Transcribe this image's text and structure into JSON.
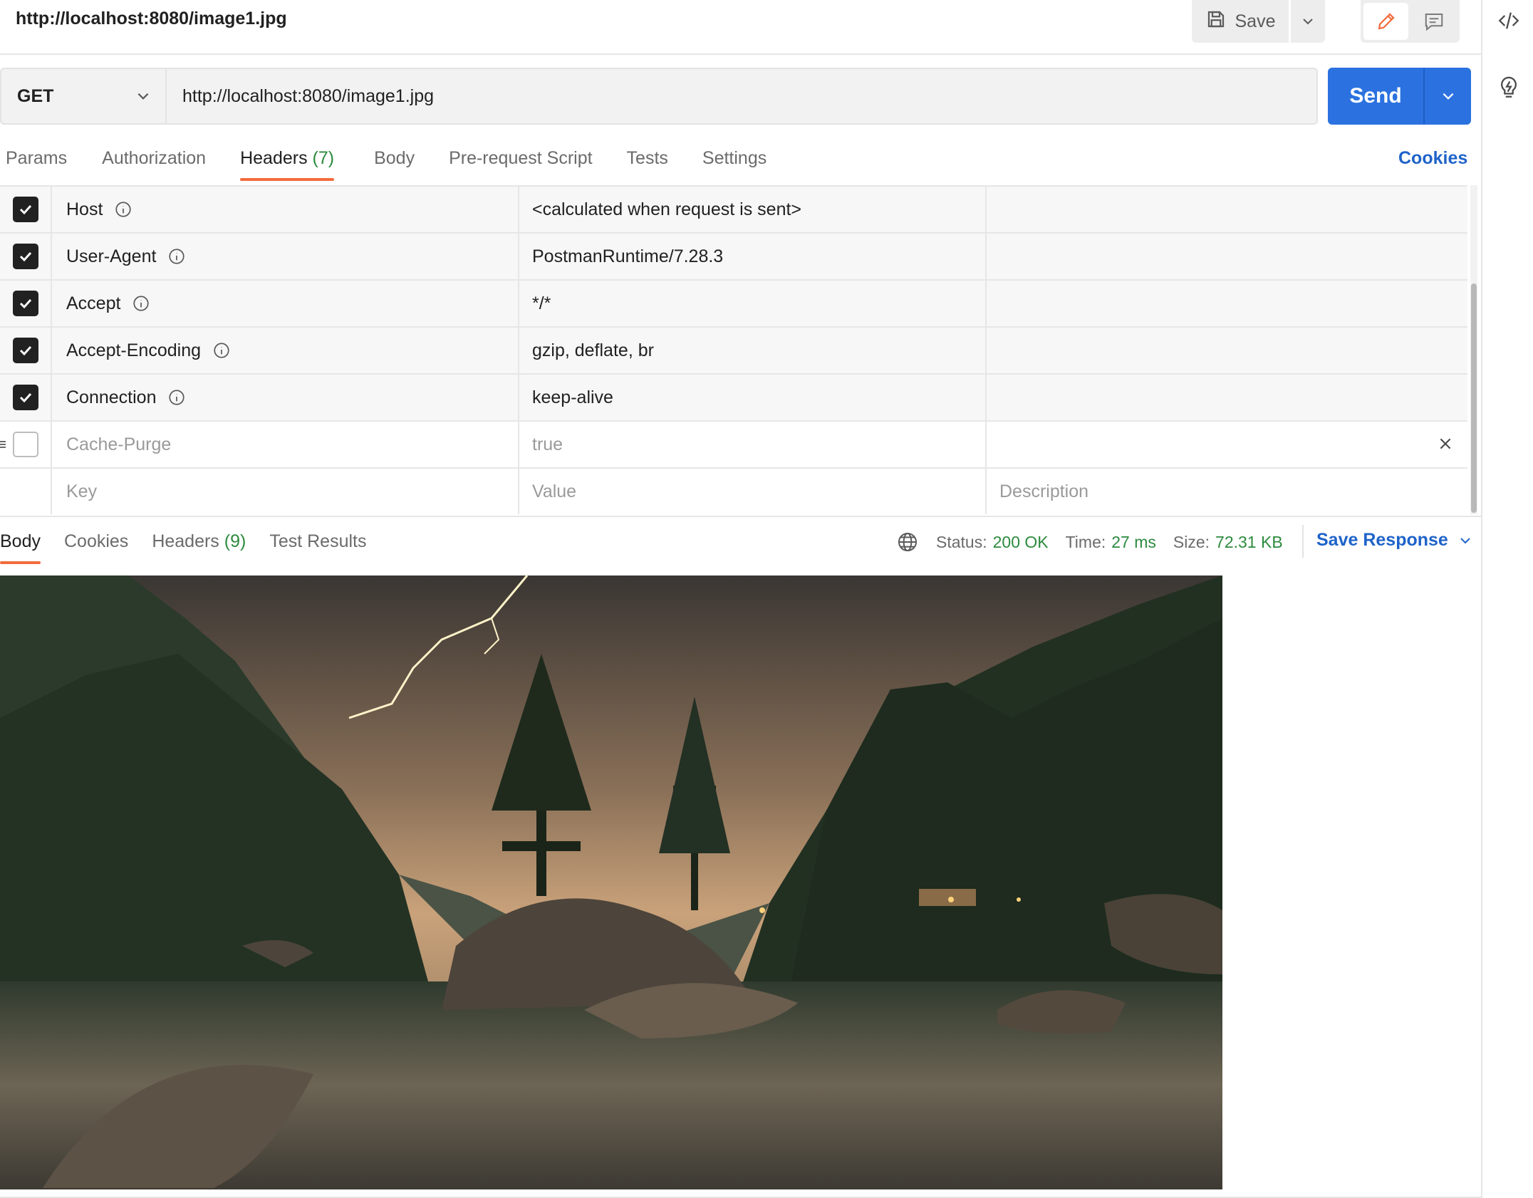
{
  "title": "http://localhost:8080/image1.jpg",
  "toolbar": {
    "save_label": "Save"
  },
  "request": {
    "method": "GET",
    "url": "http://localhost:8080/image1.jpg",
    "send_label": "Send"
  },
  "request_tabs": [
    {
      "label": "Params"
    },
    {
      "label": "Authorization"
    },
    {
      "label": "Headers",
      "count": "(7)"
    },
    {
      "label": "Body"
    },
    {
      "label": "Pre-request Script"
    },
    {
      "label": "Tests"
    },
    {
      "label": "Settings"
    }
  ],
  "active_request_tab": "Headers",
  "cookies_link": "Cookies",
  "headers": [
    {
      "key": "Host",
      "value": "<calculated when request is sent>",
      "checked": true
    },
    {
      "key": "User-Agent",
      "value": "PostmanRuntime/7.28.3",
      "checked": true
    },
    {
      "key": "Accept",
      "value": "*/*",
      "checked": true
    },
    {
      "key": "Accept-Encoding",
      "value": "gzip, deflate, br",
      "checked": true
    },
    {
      "key": "Connection",
      "value": "keep-alive",
      "checked": true
    },
    {
      "key": "Cache-Purge",
      "value": "true",
      "checked": false
    }
  ],
  "new_header": {
    "key_placeholder": "Key",
    "value_placeholder": "Value",
    "description_placeholder": "Description"
  },
  "response_tabs": [
    {
      "label": "Body"
    },
    {
      "label": "Cookies"
    },
    {
      "label": "Headers",
      "count": "(9)"
    },
    {
      "label": "Test Results"
    }
  ],
  "active_response_tab": "Body",
  "response_meta": {
    "status_label": "Status:",
    "status_value": "200 OK",
    "time_label": "Time:",
    "time_value": "27 ms",
    "size_label": "Size:",
    "size_value": "72.31 KB"
  },
  "save_response_label": "Save Response",
  "colors": {
    "accent": "#f26b3a",
    "send_button": "#2b72e0",
    "link": "#1f63c9",
    "success": "#2d8a3e"
  },
  "icons": [
    "save-icon",
    "chevron-down-icon",
    "pencil-icon",
    "comment-icon",
    "code-icon",
    "lightbulb-icon",
    "info-icon",
    "checkbox-icon",
    "drag-handle-icon",
    "close-icon",
    "globe-icon"
  ],
  "response_image": "mountain lake landscape with lightning at dusk"
}
